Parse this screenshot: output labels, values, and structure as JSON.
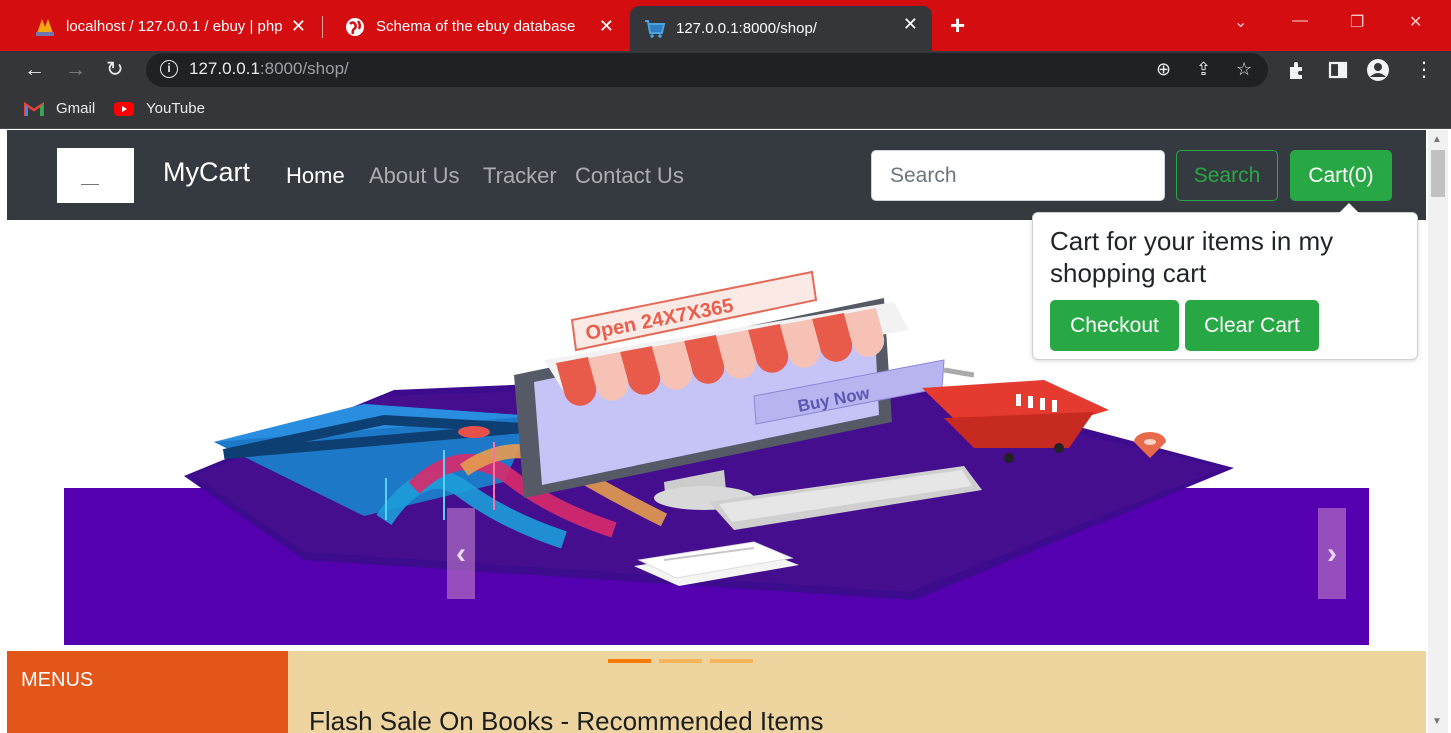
{
  "browser": {
    "tabs": [
      {
        "title": "localhost / 127.0.0.1 / ebuy | php"
      },
      {
        "title": "Schema of the ebuy database"
      },
      {
        "title": "127.0.0.1:8000/shop/",
        "active": true
      }
    ],
    "url_host": "127.0.0.1",
    "url_rest": ":8000/shop/",
    "bookmarks": [
      {
        "label": "Gmail"
      },
      {
        "label": "YouTube"
      }
    ]
  },
  "navbar": {
    "brand": "MyCart",
    "links": [
      {
        "label": "Home",
        "active": true
      },
      {
        "label": "About Us"
      },
      {
        "label": "Tracker"
      },
      {
        "label": "Contact Us"
      }
    ],
    "search_placeholder": "Search",
    "search_button": "Search",
    "cart_button": "Cart(0)"
  },
  "popover": {
    "title": "Cart for your items in my shopping cart",
    "checkout_button": "Checkout",
    "clear_button": "Clear Cart"
  },
  "carousel": {
    "image_text_sign": "Open 24X7X365",
    "image_text_button": "Buy Now",
    "slide_count": 3,
    "active_slide": 1
  },
  "sidebar": {
    "title": "MENUS"
  },
  "main": {
    "section_title": "Flash Sale On Books - Recommended Items"
  },
  "colors": {
    "tab_bar": "#d40d11",
    "chrome_dark": "#35363a",
    "navbar": "#353a40",
    "primary_green": "#28a745",
    "menus_orange": "#e3561a",
    "content_beige": "#eed5a0",
    "carousel_purple": "#5400b0"
  }
}
